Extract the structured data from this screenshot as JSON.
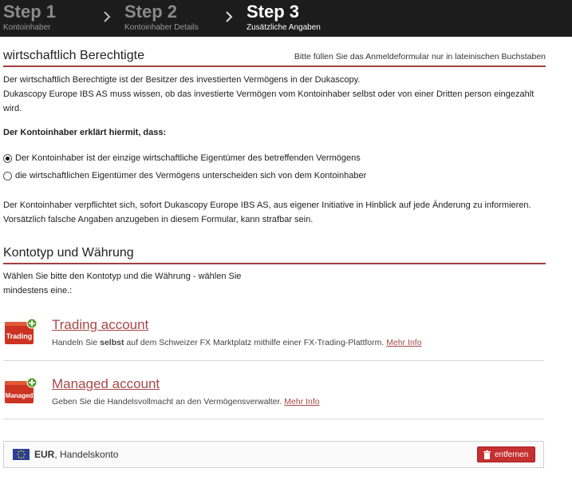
{
  "steps": [
    {
      "number": "Step 1",
      "label": "Kontoinhaber"
    },
    {
      "number": "Step 2",
      "label": "Kontoinhaber Details"
    },
    {
      "number": "Step 3",
      "label": "Zusätzliche Angaben"
    }
  ],
  "beneficiary": {
    "title": "wirtschaftlich Berechtigte",
    "note": "Bitte füllen Sie das Anmeldeformular nur in lateinischen Buchstaben",
    "para1_line1": "Der wirtschaftlich Berechtigte ist der Besitzer des investierten Vermögens in der Dukascopy.",
    "para1_line2": "Dukascopy Europe IBS AS muss wissen, ob das investierte Vermögen vom Kontoinhaber selbst oder von einer Dritten person eingezahlt",
    "para1_line3": "wird.",
    "declare": "Der Kontoinhaber erklärt hiermit, dass:",
    "option1": "Der Kontoinhaber ist der einzige wirtschaftliche Eigentümer des betreffenden Vermögens",
    "option2": "die wirtschaftlichen Eigentümer des Vermögens unterscheiden sich von dem Kontoinhaber",
    "selected_option": 1,
    "para2_line1": "Der Kontoinhaber verpflichtet sich, sofort Dukascopy Europe IBS AS, aus eigener Initiative in Hinblick auf jede Änderung zu informieren.",
    "para2_line2": "Vorsätzlich falsche Angaben anzugeben in diesem Formular, kann strafbar sein."
  },
  "account_type": {
    "title": "Kontotyp und Währung",
    "intro_line1": "Wählen  Sie  bitte  den  Kontotyp  und  die  Währung  -  wählen  Sie",
    "intro_line2": "mindestens eine.:",
    "accounts": [
      {
        "icon_label": "Trading",
        "title": "Trading account",
        "desc_pre": "Handeln Sie ",
        "desc_bold": "selbst",
        "desc_post": " auf dem Schweizer FX Marktplatz mithilfe einer FX-Trading-Plattform. ",
        "more": "Mehr Info"
      },
      {
        "icon_label": "Managed",
        "title": "Managed account",
        "desc_pre": "Geben Sie die Handelsvollmacht an den Vermögensverwalter. ",
        "more": "Mehr Info"
      }
    ]
  },
  "currency_row": {
    "code": "EUR",
    "rest": ", Handelskonto",
    "remove_label": "entfernen"
  },
  "colors": {
    "accent": "#a84848",
    "stepper_bg": "#1c1c1c",
    "remove_button": "#c63030",
    "icon_red": "#cc3322",
    "icon_plus": "#5aa02c"
  }
}
